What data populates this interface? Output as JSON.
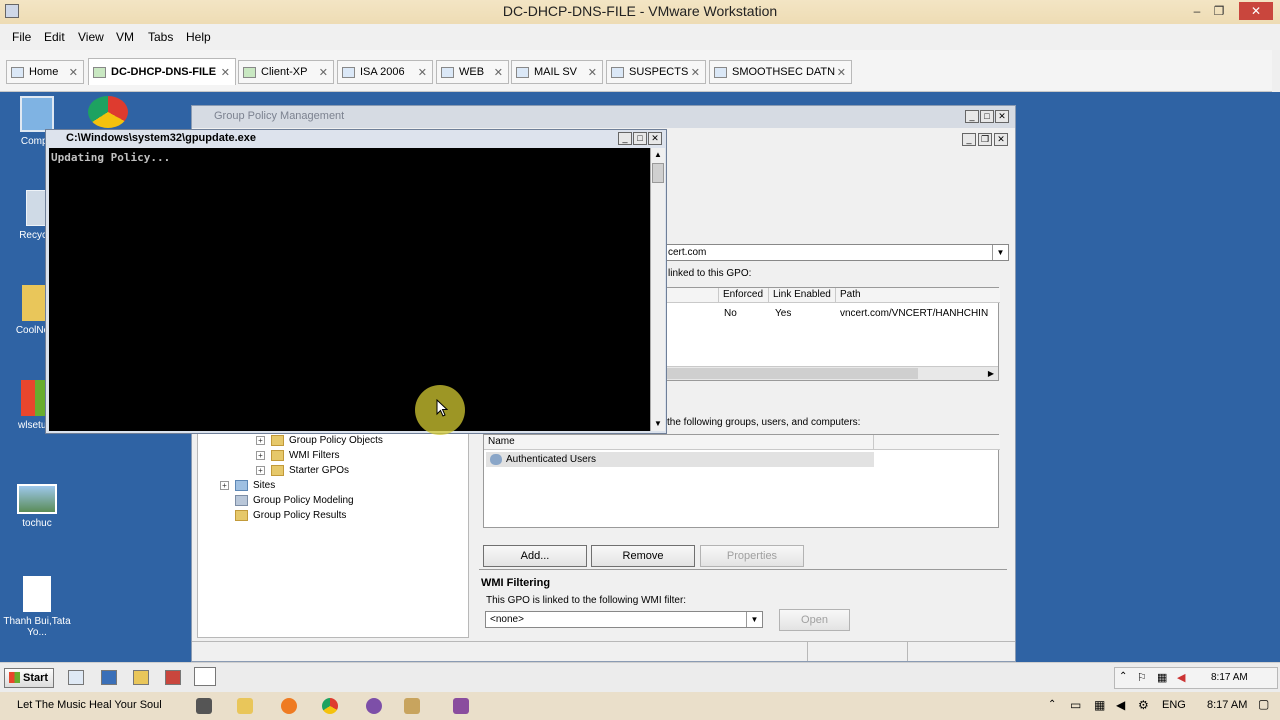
{
  "host": {
    "title": "DC-DHCP-DNS-FILE - VMware Workstation",
    "menu": [
      "File",
      "Edit",
      "View",
      "VM",
      "Tabs",
      "Help"
    ],
    "tabs": [
      "Home",
      "DC-DHCP-DNS-FILE",
      "Client-XP",
      "ISA 2006",
      "WEB",
      "MAIL SV",
      "SUSPECTS",
      "SMOOTHSEC DATN"
    ],
    "active_tab": "DC-DHCP-DNS-FILE",
    "song": "Let The Music Heal Your Soul",
    "language": "ENG",
    "clock": "8:17 AM"
  },
  "desktop": {
    "icons": [
      "Compu",
      "Recycle",
      "CoolNov",
      "wlsetup",
      "tochuc",
      "Thanh Bui,Tata Yo..."
    ]
  },
  "gpm": {
    "title": "Group Policy Management",
    "tree": [
      "Group Policy Objects",
      "WMI Filters",
      "Starter GPOs",
      "Sites",
      "Group Policy Modeling",
      "Group Policy Results"
    ],
    "domain_value": "cert.com",
    "linked_label": "linked to this GPO:",
    "links_columns": [
      "Enforced",
      "Link Enabled",
      "Path"
    ],
    "links_row": {
      "enforced": "No",
      "link_enabled": "Yes",
      "path": "vncert.com/VNCERT/HANHCHIN"
    },
    "security_label": "the following groups, users, and computers:",
    "security_column": "Name",
    "security_row": "Authenticated Users",
    "buttons": {
      "add": "Add...",
      "remove": "Remove",
      "properties": "Properties"
    },
    "wmi_heading": "WMI Filtering",
    "wmi_label": "This GPO is linked to the following WMI filter:",
    "wmi_value": "<none>",
    "open_button": "Open"
  },
  "cmd": {
    "title": "C:\\Windows\\system32\\gpupdate.exe",
    "output": "Updating Policy..."
  },
  "guest_taskbar": {
    "start": "Start",
    "clock": "8:17 AM"
  }
}
